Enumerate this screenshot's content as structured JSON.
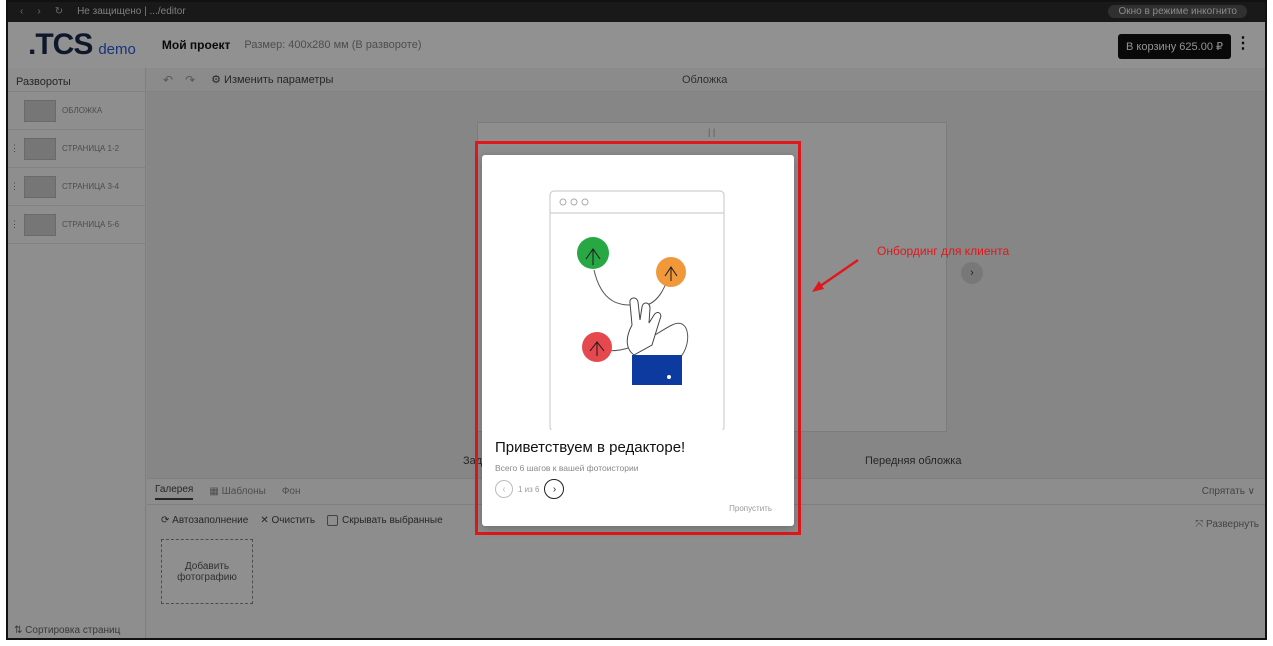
{
  "browser": {
    "nav_back": "‹",
    "nav_forward": "›",
    "reload": "↻",
    "url": "Не защищено | .../editor",
    "profile_label": "Окно в режиме инкогнито"
  },
  "header": {
    "logo": ".TCS",
    "logo_suffix": "demo",
    "project_name": "Мой проект",
    "project_size": "Размер: 400х280 мм (В развороте)",
    "cart_button": "В корзину 625.00 ₽",
    "menu_icon": "⋮"
  },
  "sidebar": {
    "title": "Развороты",
    "spreads": [
      {
        "label": "ОБЛОЖКА"
      },
      {
        "label": "СТРАНИЦА 1-2"
      },
      {
        "label": "СТРАНИЦА 3-4"
      },
      {
        "label": "СТРАНИЦА 5-6"
      }
    ],
    "sort_label": "⇅ Сортировка страниц"
  },
  "toolbar": {
    "undo_icon": "↶",
    "redo_icon": "↷",
    "change_params": "⚙ Изменить параметры",
    "cover_title": "Обложка"
  },
  "canvas": {
    "spine_mark": "| |",
    "back_cover_label": "Задняя обложка",
    "front_cover_label": "Передняя обложка",
    "next_icon": "›"
  },
  "bottom_panel": {
    "tabs": [
      {
        "label": "Галерея"
      },
      {
        "label": "▦ Шаблоны"
      },
      {
        "label": "Фон"
      }
    ],
    "hide_label": "Спрятать ∨",
    "autofill": "⟳ Автозаполнение",
    "clear": "✕ Очистить",
    "hide_selected": "Скрывать выбранные",
    "expand": "⤧ Развернуть",
    "add_photo": "Добавить фотографию"
  },
  "onboarding": {
    "title": "Приветствуем в редакторе!",
    "subtitle": "Всего 6 шагов к вашей фотоистории",
    "prev_icon": "‹",
    "counter": "1 из 6",
    "next_icon": "›",
    "skip": "Пропустить",
    "colors": {
      "green": "#28a745",
      "orange": "#f0983a",
      "red": "#e5484d",
      "cuff": "#0d3a9e"
    }
  },
  "annotation": {
    "text": "Онбординг для клиента",
    "color": "#e0171b"
  }
}
